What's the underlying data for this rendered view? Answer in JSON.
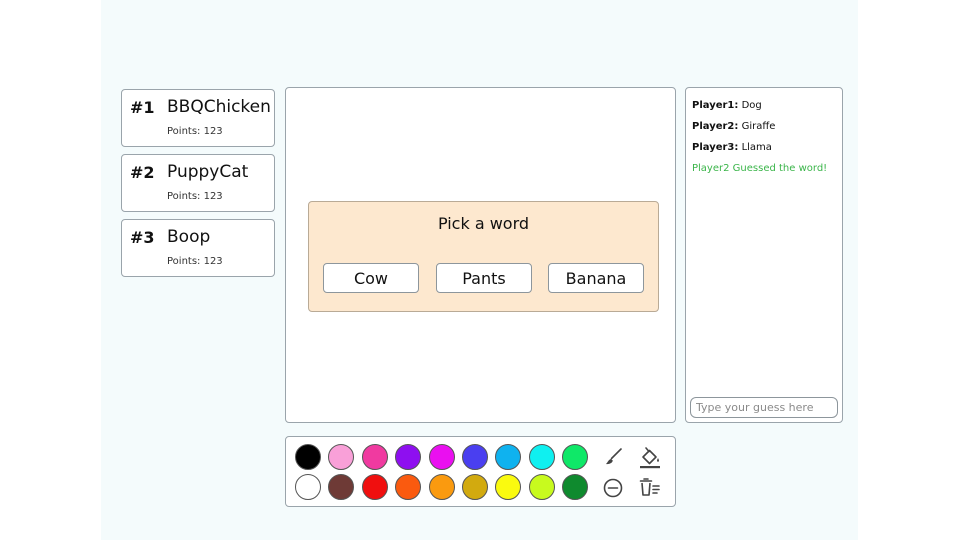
{
  "leaderboard": [
    {
      "rank": "#1",
      "name": "BBQChicken",
      "points": "Points: 123"
    },
    {
      "rank": "#2",
      "name": "PuppyCat",
      "points": "Points: 123"
    },
    {
      "rank": "#3",
      "name": "Boop",
      "points": "Points: 123"
    }
  ],
  "pick": {
    "title": "Pick a word",
    "words": [
      "Cow",
      "Pants",
      "Banana"
    ]
  },
  "chat": {
    "messages": [
      {
        "player": "Player1:",
        "text": " Dog"
      },
      {
        "player": "Player2:",
        "text": " Giraffe"
      },
      {
        "player": "Player3:",
        "text": " Llama"
      }
    ],
    "system_message": "Player2 Guessed the word!",
    "input_placeholder": "Type your guess here"
  },
  "palette": {
    "row1": [
      "#000000",
      "#f9a0d8",
      "#f03aa0",
      "#8e0ff0",
      "#ea0ff0",
      "#4a3ff0",
      "#0fb2ef",
      "#0ff0f0",
      "#0fe868"
    ],
    "row2": [
      "#ffffff",
      "#6e3a36",
      "#f00f0f",
      "#fa5a0f",
      "#fa9a0f",
      "#d2aa0f",
      "#fafa0f",
      "#c8fa1e",
      "#0f8a2e"
    ],
    "tools": [
      "brush-icon",
      "fill-bucket-icon",
      "eraser-icon",
      "trash-icon"
    ]
  }
}
